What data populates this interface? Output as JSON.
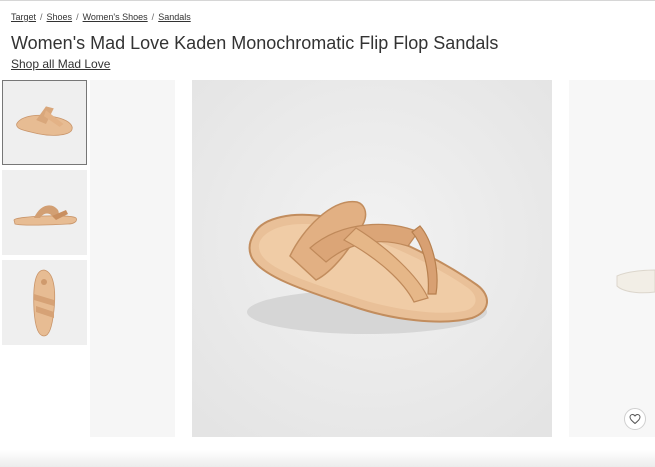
{
  "breadcrumb": {
    "items": [
      "Target",
      "Shoes",
      "Women's Shoes",
      "Sandals"
    ],
    "separator": "/"
  },
  "product": {
    "title": "Women's Mad Love Kaden Monochromatic Flip Flop Sandals",
    "brand_link": "Shop all Mad Love"
  },
  "gallery": {
    "thumbnails": [
      {
        "view": "angle-view",
        "selected": true
      },
      {
        "view": "side-view",
        "selected": false
      },
      {
        "view": "top-view",
        "selected": false
      }
    ],
    "favorite_icon": "heart-icon"
  },
  "colors": {
    "sandal": "#e7bc93",
    "sandal_dark": "#c9956a",
    "background": "#ececec"
  }
}
